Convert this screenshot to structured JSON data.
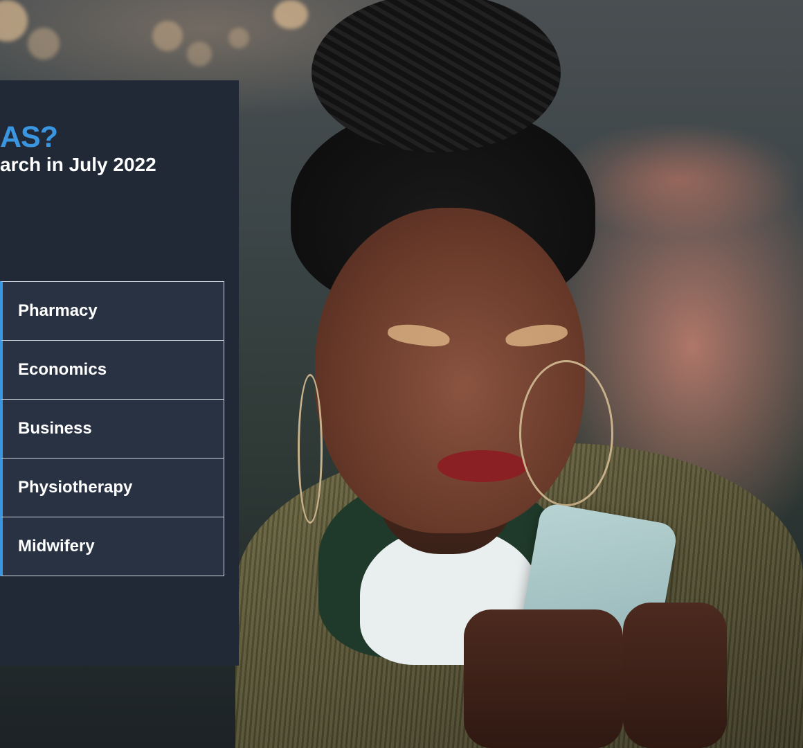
{
  "panel": {
    "heading": "AS?",
    "subheading": "arch in July 2022"
  },
  "subjects": [
    {
      "label": "Pharmacy"
    },
    {
      "label": "Economics"
    },
    {
      "label": "Business"
    },
    {
      "label": "Physiotherapy"
    },
    {
      "label": "Midwifery"
    }
  ],
  "colors": {
    "panel_background": "#212836",
    "accent": "#3a96e0",
    "list_item_background": "#283242",
    "text": "#ffffff"
  },
  "background_image": {
    "icon": "person-using-phone-photo"
  }
}
